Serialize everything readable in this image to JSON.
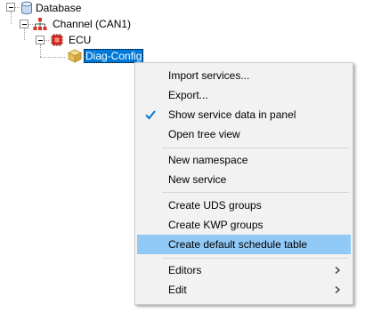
{
  "tree": {
    "nodes": [
      {
        "label": "Database",
        "icon": "database-icon"
      },
      {
        "label": "Channel (CAN1)",
        "icon": "network-icon"
      },
      {
        "label": "ECU",
        "icon": "ecu-chip-icon"
      },
      {
        "label": "Diag-Config",
        "icon": "box-package-icon",
        "selected": true
      }
    ]
  },
  "context_menu": {
    "groups": [
      [
        {
          "label": "Import services...",
          "checked": false,
          "submenu": false
        },
        {
          "label": "Export...",
          "checked": false,
          "submenu": false
        },
        {
          "label": "Show service data in panel",
          "checked": true,
          "submenu": false
        },
        {
          "label": "Open tree view",
          "checked": false,
          "submenu": false
        }
      ],
      [
        {
          "label": "New namespace",
          "checked": false,
          "submenu": false
        },
        {
          "label": "New service",
          "checked": false,
          "submenu": false
        }
      ],
      [
        {
          "label": "Create UDS groups",
          "checked": false,
          "submenu": false
        },
        {
          "label": "Create KWP groups",
          "checked": false,
          "submenu": false
        },
        {
          "label": "Create default schedule table",
          "checked": false,
          "submenu": false,
          "highlighted": true
        }
      ],
      [
        {
          "label": "Editors",
          "checked": false,
          "submenu": true
        },
        {
          "label": "Edit",
          "checked": false,
          "submenu": true
        }
      ]
    ]
  },
  "colors": {
    "selection": "#0078d7",
    "menu_highlight": "#91c9f7",
    "menu_background": "#f2f2f2",
    "check_mark": "#0078d7"
  }
}
